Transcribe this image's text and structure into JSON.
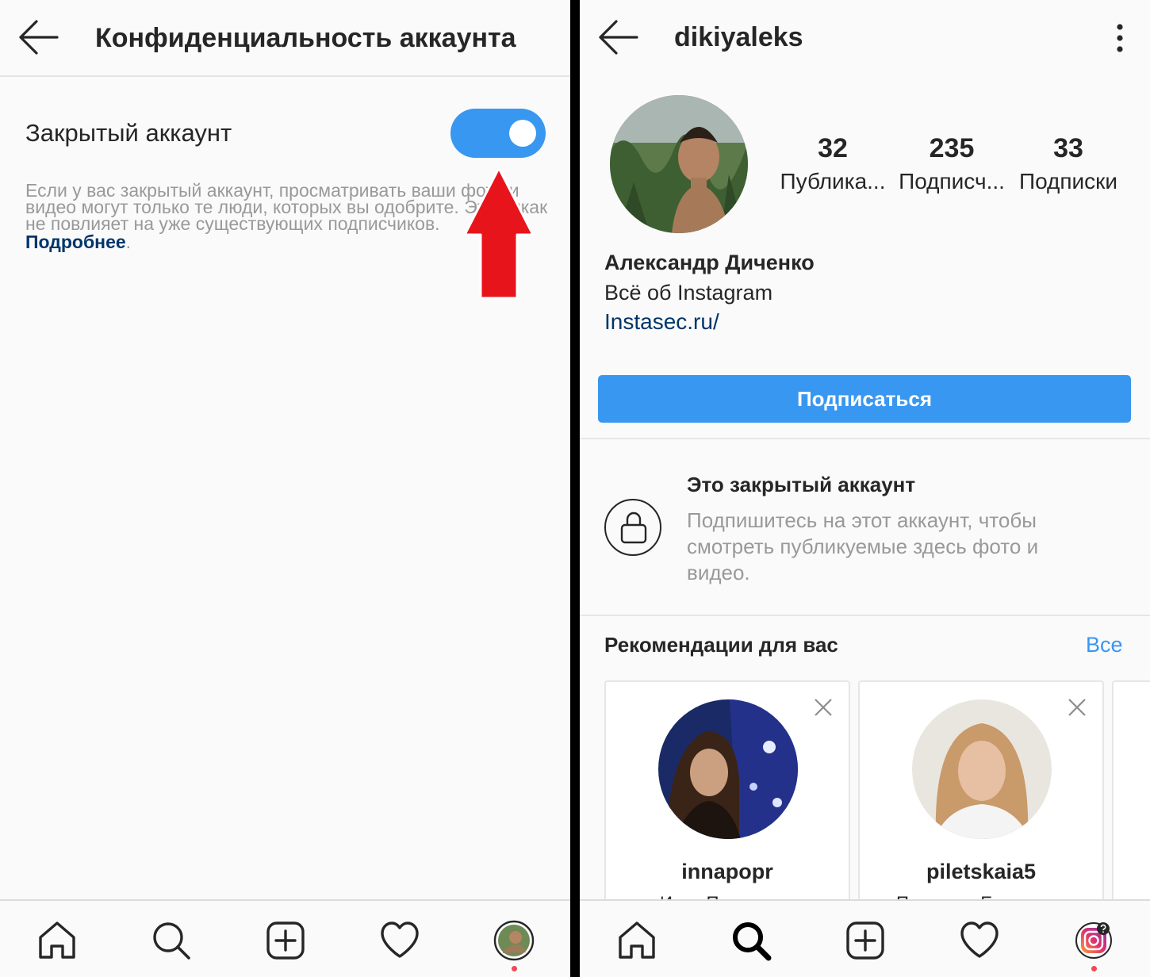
{
  "left": {
    "title": "Конфиденциальность аккаунта",
    "setting": {
      "label": "Закрытый аккаунт",
      "toggle_on": true,
      "description": "Если у вас закрытый аккаунт, просматривать ваши фото и видео могут только те люди, которых вы одобрите. Это никак не повлияет на уже существующих подписчиков.",
      "more_link": "Подробнее"
    },
    "annotation": "red-arrow-pointing-at-toggle",
    "nav": [
      "home-icon",
      "search-icon",
      "add-post-icon",
      "heart-icon",
      "profile-avatar"
    ]
  },
  "right": {
    "username": "dikiyaleks",
    "stats": [
      {
        "value": "32",
        "label": "Публика..."
      },
      {
        "value": "235",
        "label": "Подписч..."
      },
      {
        "value": "33",
        "label": "Подписки"
      }
    ],
    "full_name": "Александр Диченко",
    "bio": "Всё об Instagram",
    "website": "Instasec.ru/",
    "follow_button": "Подписаться",
    "private_notice": {
      "title": "Это закрытый аккаунт",
      "text": "Подпишитесь на этот аккаунт, чтобы смотреть публикуемые здесь фото и видео."
    },
    "recommendations": {
      "title": "Рекомендации для вас",
      "see_all": "Все",
      "cards": [
        {
          "username": "innapopr",
          "full_name": "Инна Попроцкая"
        },
        {
          "username": "piletskaia5",
          "full_name": "Пилецкая Екатерина"
        }
      ]
    },
    "nav": [
      "home-icon",
      "search-icon",
      "add-post-icon",
      "heart-icon",
      "profile-avatar"
    ]
  },
  "colors": {
    "accent": "#3897f0",
    "link": "#003569",
    "arrow": "#e8141c",
    "notification": "#ed4956"
  }
}
